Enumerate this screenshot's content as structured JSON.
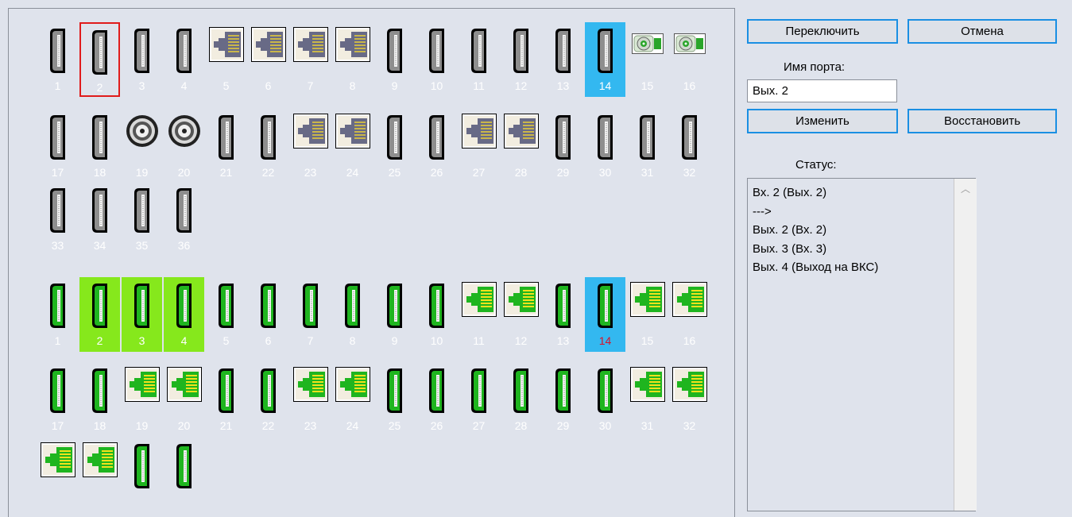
{
  "inputs": [
    {
      "n": "1",
      "type": "hdmi"
    },
    {
      "n": "2",
      "type": "hdmi",
      "state": "red"
    },
    {
      "n": "3",
      "type": "hdmi"
    },
    {
      "n": "4",
      "type": "hdmi"
    },
    {
      "n": "5",
      "type": "rj45"
    },
    {
      "n": "6",
      "type": "rj45"
    },
    {
      "n": "7",
      "type": "rj45"
    },
    {
      "n": "8",
      "type": "rj45"
    },
    {
      "n": "9",
      "type": "hdmi"
    },
    {
      "n": "10",
      "type": "hdmi"
    },
    {
      "n": "11",
      "type": "hdmi"
    },
    {
      "n": "12",
      "type": "hdmi"
    },
    {
      "n": "13",
      "type": "hdmi"
    },
    {
      "n": "14",
      "type": "hdmi",
      "state": "blue"
    },
    {
      "n": "15",
      "type": "sdi"
    },
    {
      "n": "16",
      "type": "sdi"
    },
    {
      "n": "17",
      "type": "hdmi"
    },
    {
      "n": "18",
      "type": "hdmi"
    },
    {
      "n": "19",
      "type": "bnc"
    },
    {
      "n": "20",
      "type": "bnc"
    },
    {
      "n": "21",
      "type": "hdmi"
    },
    {
      "n": "22",
      "type": "hdmi"
    },
    {
      "n": "23",
      "type": "rj45"
    },
    {
      "n": "24",
      "type": "rj45"
    },
    {
      "n": "25",
      "type": "hdmi"
    },
    {
      "n": "26",
      "type": "hdmi"
    },
    {
      "n": "27",
      "type": "rj45"
    },
    {
      "n": "28",
      "type": "rj45"
    },
    {
      "n": "29",
      "type": "hdmi"
    },
    {
      "n": "30",
      "type": "hdmi"
    },
    {
      "n": "31",
      "type": "hdmi"
    },
    {
      "n": "32",
      "type": "hdmi"
    },
    {
      "n": "33",
      "type": "hdmi"
    },
    {
      "n": "34",
      "type": "hdmi"
    },
    {
      "n": "35",
      "type": "hdmi"
    },
    {
      "n": "36",
      "type": "hdmi"
    }
  ],
  "outputs": [
    {
      "n": "1",
      "type": "hdmi"
    },
    {
      "n": "2",
      "type": "hdmi",
      "state": "green"
    },
    {
      "n": "3",
      "type": "hdmi",
      "state": "green"
    },
    {
      "n": "4",
      "type": "hdmi",
      "state": "green"
    },
    {
      "n": "5",
      "type": "hdmi"
    },
    {
      "n": "6",
      "type": "hdmi"
    },
    {
      "n": "7",
      "type": "hdmi"
    },
    {
      "n": "8",
      "type": "hdmi"
    },
    {
      "n": "9",
      "type": "hdmi"
    },
    {
      "n": "10",
      "type": "hdmi"
    },
    {
      "n": "11",
      "type": "rj45"
    },
    {
      "n": "12",
      "type": "rj45"
    },
    {
      "n": "13",
      "type": "hdmi"
    },
    {
      "n": "14",
      "type": "hdmi",
      "state": "blue",
      "numcolor": "red"
    },
    {
      "n": "15",
      "type": "rj45"
    },
    {
      "n": "16",
      "type": "rj45"
    },
    {
      "n": "17",
      "type": "hdmi"
    },
    {
      "n": "18",
      "type": "hdmi"
    },
    {
      "n": "19",
      "type": "rj45"
    },
    {
      "n": "20",
      "type": "rj45"
    },
    {
      "n": "21",
      "type": "hdmi"
    },
    {
      "n": "22",
      "type": "hdmi"
    },
    {
      "n": "23",
      "type": "rj45"
    },
    {
      "n": "24",
      "type": "rj45"
    },
    {
      "n": "25",
      "type": "hdmi"
    },
    {
      "n": "26",
      "type": "hdmi"
    },
    {
      "n": "27",
      "type": "hdmi"
    },
    {
      "n": "28",
      "type": "hdmi"
    },
    {
      "n": "29",
      "type": "hdmi"
    },
    {
      "n": "30",
      "type": "hdmi"
    },
    {
      "n": "31",
      "type": "rj45"
    },
    {
      "n": "32",
      "type": "rj45"
    },
    {
      "n": "",
      "type": "rj45"
    },
    {
      "n": "",
      "type": "rj45"
    },
    {
      "n": "",
      "type": "hdmi"
    },
    {
      "n": "",
      "type": "hdmi"
    }
  ],
  "panel": {
    "switch_label": "Переключить",
    "cancel_label": "Отмена",
    "port_name_label": "Имя порта:",
    "port_name_value": "Вых. 2",
    "change_label": "Изменить",
    "restore_label": "Восстановить",
    "status_label": "Статус:",
    "status_lines": [
      "Вх. 2 (Вых. 2)",
      "--->",
      "Вых. 2 (Вх. 2)",
      "Вых. 3 (Вх. 3)",
      "Вых. 4 (Выход на ВКС)"
    ],
    "scroll_up_icon": "chevron-up-icon"
  },
  "colors": {
    "input_port_fill": "#8e8e8e",
    "output_port_fill": "#1fb51f",
    "selected_blue": "#33b8f0",
    "selected_green": "#86e81c",
    "selected_border_red": "#e01b1b",
    "button_border": "#1a8fe3"
  }
}
